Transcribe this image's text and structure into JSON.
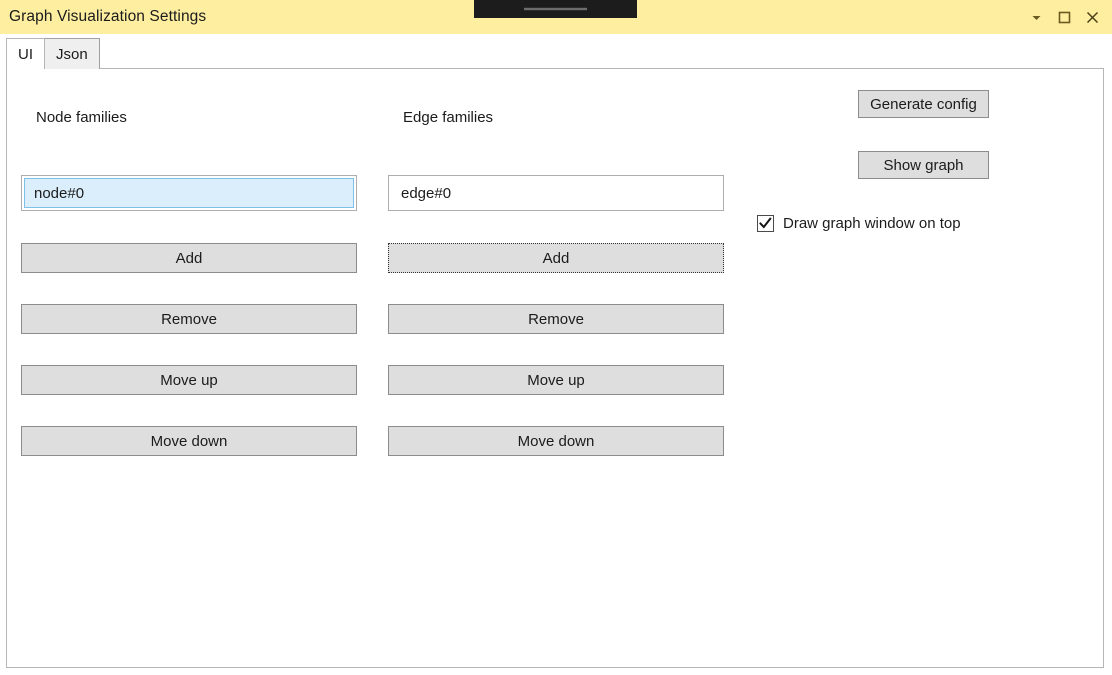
{
  "window": {
    "title": "Graph Visualization Settings",
    "titlebar_color": "#fdeea0",
    "controls": [
      {
        "name": "minimize",
        "icon": "chevron-down-icon"
      },
      {
        "name": "maximize",
        "icon": "maximize-square-icon"
      },
      {
        "name": "close",
        "icon": "close-x-icon"
      }
    ]
  },
  "overlay": {
    "name": "floating-drag-handle",
    "background": "#1c1c1c",
    "handle_color": "#6d6d6d"
  },
  "tabs": [
    {
      "label": "UI",
      "active": true
    },
    {
      "label": "Json",
      "active": false
    }
  ],
  "node_column": {
    "heading": "Node families",
    "listbox": {
      "items": [
        {
          "text": "node#0",
          "selected": true
        }
      ],
      "selection_fill": "#daeffb",
      "selection_border": "#7fc0e8"
    },
    "buttons": [
      {
        "label": "Add",
        "focused": false
      },
      {
        "label": "Remove",
        "focused": false
      },
      {
        "label": "Move up",
        "focused": false
      },
      {
        "label": "Move down",
        "focused": false
      }
    ]
  },
  "edge_column": {
    "heading": "Edge families",
    "listbox": {
      "items": [
        {
          "text": "edge#0",
          "selected": false
        }
      ]
    },
    "buttons": [
      {
        "label": "Add",
        "focused": true
      },
      {
        "label": "Remove",
        "focused": false
      },
      {
        "label": "Move up",
        "focused": false
      },
      {
        "label": "Move down",
        "focused": false
      }
    ]
  },
  "right_panel": {
    "generate_config_label": "Generate config",
    "show_graph_label": "Show graph",
    "checkbox": {
      "label": "Draw graph window on top",
      "checked": true
    }
  },
  "theme": {
    "button_face": "#dedede",
    "button_border": "#8c8c8c",
    "panel_border": "#b6b6b6",
    "text": "#1b1b1b"
  }
}
